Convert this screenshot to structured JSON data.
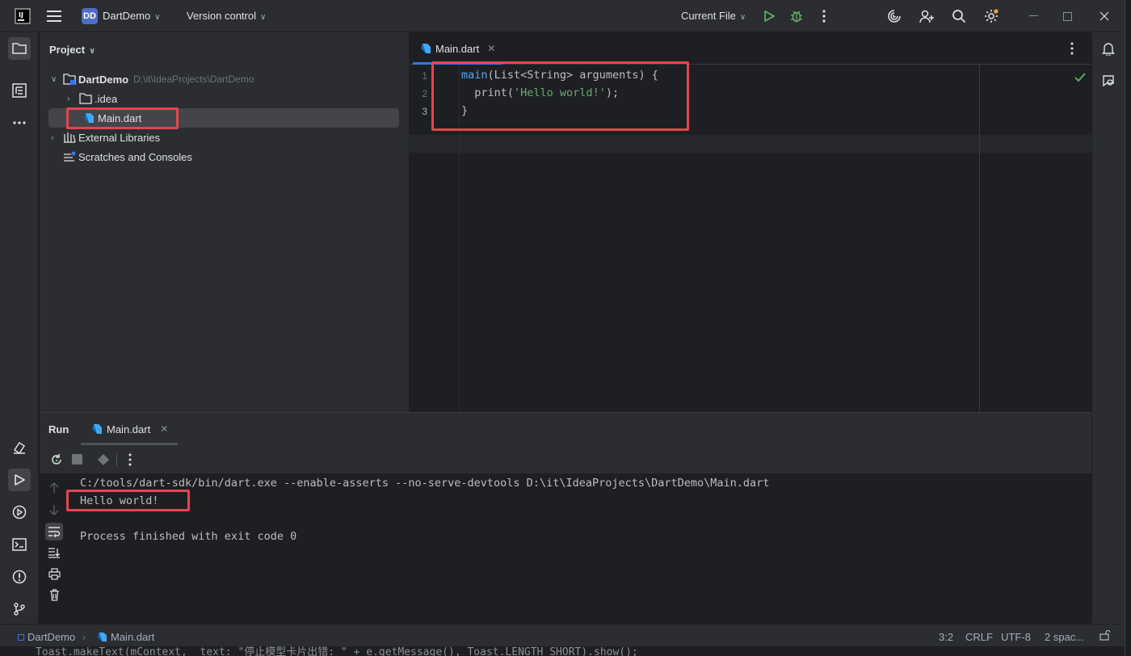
{
  "titlebar": {
    "project_badge": "DD",
    "project_name": "DartDemo",
    "version_control": "Version control",
    "run_config": "Current File",
    "window_controls": [
      "minimize",
      "maximize",
      "close"
    ]
  },
  "project_panel": {
    "title": "Project",
    "tree": [
      {
        "label": "DartDemo",
        "path": "D:\\it\\IdeaProjects\\DartDemo",
        "icon": "module-folder-icon",
        "expanded": true
      },
      {
        "label": ".idea",
        "icon": "folder-icon",
        "expanded": false
      },
      {
        "label": "Main.dart",
        "icon": "dart-file-icon",
        "selected": true
      },
      {
        "label": "External Libraries",
        "icon": "library-icon",
        "expanded": false
      },
      {
        "label": "Scratches and Consoles",
        "icon": "scratches-icon"
      }
    ]
  },
  "editor": {
    "tab_label": "Main.dart",
    "line_numbers": [
      "1",
      "2",
      "3"
    ],
    "code": {
      "l1_fn": "main",
      "l1_rest": "(List<String> arguments) {",
      "l2_indent": "  print(",
      "l2_str": "'Hello world!'",
      "l2_end": ");",
      "l3": "}"
    }
  },
  "run_panel": {
    "title": "Run",
    "tab_label": "Main.dart",
    "output": [
      "C:/tools/dart-sdk/bin/dart.exe --enable-asserts --no-serve-devtools D:\\it\\IdeaProjects\\DartDemo\\Main.dart",
      "Hello world!",
      "",
      "Process finished with exit code 0"
    ]
  },
  "statusbar": {
    "breadcrumb_project": "DartDemo",
    "breadcrumb_file": "Main.dart",
    "position": "3:2",
    "line_ending": "CRLF",
    "encoding": "UTF-8",
    "indent": "2 spac..."
  },
  "below_window_text": "Toast.makeText(mContext,  text: \"停止模型卡片出错: \" + e.getMessage(), Toast.LENGTH_SHORT).show();",
  "colors": {
    "accent": "#3574f0",
    "highlight": "#e5454f",
    "run_green": "#5fb865",
    "dart_blue": "#40a8f5"
  }
}
